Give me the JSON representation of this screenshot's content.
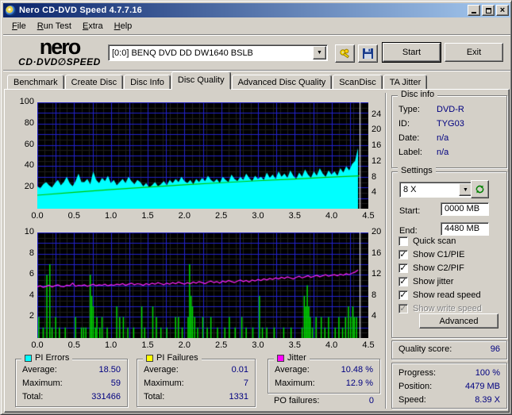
{
  "window": {
    "title": "Nero CD-DVD Speed 4.7.7.16"
  },
  "menu": {
    "items": [
      "File",
      "Run Test",
      "Extra",
      "Help"
    ]
  },
  "toolbar": {
    "logo_line1": "nero",
    "logo_cd": "CD·DVD",
    "logo_slash": "∅",
    "logo_speed": "SPEED",
    "drive_selector": "[0:0]   BENQ DVD DD DW1640 BSLB",
    "start_label": "Start",
    "exit_label": "Exit"
  },
  "tabs": {
    "items": [
      "Benchmark",
      "Create Disc",
      "Disc Info",
      "Disc Quality",
      "Advanced Disc Quality",
      "ScanDisc",
      "TA Jitter"
    ],
    "active": "Disc Quality"
  },
  "disc_info": {
    "title": "Disc info",
    "rows": [
      {
        "label": "Type:",
        "value": "DVD-R"
      },
      {
        "label": "ID:",
        "value": "TYG03"
      },
      {
        "label": "Date:",
        "value": "n/a"
      },
      {
        "label": "Label:",
        "value": "n/a"
      }
    ]
  },
  "settings": {
    "title": "Settings",
    "speed_value": "8 X",
    "start_label": "Start:",
    "start_value": "0000 MB",
    "end_label": "End:",
    "end_value": "4480 MB",
    "checkboxes": [
      {
        "label": "Quick scan",
        "checked": false,
        "disabled": false
      },
      {
        "label": "Show C1/PIE",
        "checked": true,
        "disabled": false
      },
      {
        "label": "Show C2/PIF",
        "checked": true,
        "disabled": false
      },
      {
        "label": "Show jitter",
        "checked": true,
        "disabled": false
      },
      {
        "label": "Show read speed",
        "checked": true,
        "disabled": false
      },
      {
        "label": "Show write speed",
        "checked": true,
        "disabled": true
      }
    ],
    "advanced_label": "Advanced"
  },
  "quality": {
    "label": "Quality score:",
    "value": "96"
  },
  "status": {
    "rows": [
      {
        "label": "Progress:",
        "value": "100 %"
      },
      {
        "label": "Position:",
        "value": "4479 MB"
      },
      {
        "label": "Speed:",
        "value": "8.39 X"
      }
    ]
  },
  "legends": {
    "pi_errors": {
      "title": "PI Errors",
      "swatch": "#00ffff",
      "rows": [
        {
          "label": "Average:",
          "value": "18.50"
        },
        {
          "label": "Maximum:",
          "value": "59"
        },
        {
          "label": "Total:",
          "value": "331466"
        }
      ]
    },
    "pi_failures": {
      "title": "PI Failures",
      "swatch": "#ffff00",
      "rows": [
        {
          "label": "Average:",
          "value": "0.01"
        },
        {
          "label": "Maximum:",
          "value": "7"
        },
        {
          "label": "Total:",
          "value": "1331"
        }
      ]
    },
    "jitter": {
      "title": "Jitter",
      "swatch": "#ff00ff",
      "rows": [
        {
          "label": "Average:",
          "value": "10.48 %"
        },
        {
          "label": "Maximum:",
          "value": "12.9 %"
        }
      ]
    },
    "po_failures": {
      "label": "PO failures:",
      "value": "0"
    }
  },
  "colors": {
    "face": "#d4d0c8",
    "value_text": "#000080",
    "title_gradient_left": "#0a246a",
    "title_gradient_right": "#a6caf0",
    "chart_bg": "#000000",
    "grid_major": "#2222cc",
    "grid_minor": "#1e1e1e",
    "cursor": "#ffffff"
  },
  "chart_data": [
    {
      "id": "pie",
      "type": "area",
      "title": "PI Errors scan (cyan area) with read speed overlay (green line)",
      "x_axis": {
        "min": 0,
        "max": 4.5,
        "tick_step": 0.5,
        "minor_step": 0.1,
        "major_step": 0.25,
        "tick_labels": [
          "0.0",
          "0.5",
          "1.0",
          "1.5",
          "2.0",
          "2.5",
          "3.0",
          "3.5",
          "4.0",
          "4.5"
        ]
      },
      "left_axis": {
        "min": 0,
        "max": 100,
        "ticks": [
          20,
          40,
          60,
          80,
          100
        ],
        "minor_step": 5,
        "major_step": 10
      },
      "right_axis": {
        "min": 0,
        "max": 27.2,
        "ticks": [
          4,
          8,
          12,
          16,
          20,
          24
        ]
      },
      "cursor_x": 4.38,
      "series": [
        {
          "name": "pi_errors",
          "kind": "area",
          "axis": "left",
          "color": "#00ffff",
          "x_start": 0,
          "x_step": 0.04,
          "y": [
            21,
            19,
            23,
            25,
            22,
            20,
            24,
            27,
            22,
            25,
            30,
            24,
            21,
            26,
            33,
            25,
            25,
            28,
            23,
            35,
            27,
            24,
            29,
            26,
            31,
            24,
            27,
            22,
            25,
            28,
            24,
            30,
            26,
            23,
            27,
            25,
            21,
            24,
            20,
            22,
            25,
            21,
            23,
            26,
            22,
            27,
            24,
            28,
            25,
            30,
            26,
            24,
            27,
            23,
            28,
            25,
            29,
            26,
            31,
            27,
            25,
            28,
            24,
            30,
            27,
            25,
            32,
            28,
            26,
            30,
            27,
            33,
            29,
            26,
            31,
            28,
            30,
            27,
            34,
            29,
            32,
            28,
            35,
            30,
            33,
            29,
            36,
            31,
            28,
            34,
            30,
            37,
            32,
            29,
            35,
            31,
            38,
            33,
            30,
            36,
            32,
            35,
            31,
            38,
            34,
            40,
            36,
            42,
            45,
            57
          ]
        },
        {
          "name": "read_speed",
          "kind": "line",
          "axis": "right",
          "color": "#00c800",
          "points": [
            [
              0,
              3.45
            ],
            [
              0.5,
              4.2
            ],
            [
              1,
              4.9
            ],
            [
              1.5,
              5.5
            ],
            [
              2,
              6.1
            ],
            [
              2.5,
              6.65
            ],
            [
              3,
              7.15
            ],
            [
              3.5,
              7.6
            ],
            [
              4,
              8.1
            ],
            [
              4.38,
              8.39
            ]
          ]
        }
      ]
    },
    {
      "id": "pif",
      "type": "bar",
      "title": "PI Failures scan (green bars) with jitter overlay (magenta line, %)",
      "x_axis": {
        "min": 0,
        "max": 4.5,
        "tick_step": 0.5,
        "minor_step": 0.1,
        "major_step": 0.25,
        "tick_labels": [
          "0.0",
          "0.5",
          "1.0",
          "1.5",
          "2.0",
          "2.5",
          "3.0",
          "3.5",
          "4.0",
          "4.5"
        ]
      },
      "left_axis": {
        "min": 0,
        "max": 10,
        "ticks": [
          2,
          4,
          6,
          8,
          10
        ],
        "minor_step": 0.5,
        "major_step": 1
      },
      "right_axis": {
        "min": 0,
        "max": 20,
        "ticks": [
          4,
          8,
          12,
          16,
          20
        ]
      },
      "cursor_x": 4.38,
      "series": [
        {
          "name": "pi_failures",
          "kind": "bars",
          "axis": "left",
          "color": "#00dc00",
          "bars": [
            [
              0.02,
              2
            ],
            [
              0.08,
              1
            ],
            [
              0.13,
              6
            ],
            [
              0.17,
              7
            ],
            [
              0.2,
              1
            ],
            [
              0.25,
              2
            ],
            [
              0.3,
              1
            ],
            [
              0.38,
              1
            ],
            [
              0.52,
              2
            ],
            [
              0.6,
              1
            ],
            [
              0.63,
              1
            ],
            [
              0.66,
              1
            ],
            [
              0.72,
              6
            ],
            [
              0.74,
              4
            ],
            [
              0.76,
              3
            ],
            [
              0.79,
              1
            ],
            [
              0.81,
              2
            ],
            [
              0.85,
              1
            ],
            [
              0.88,
              2
            ],
            [
              0.95,
              1
            ],
            [
              1.08,
              3
            ],
            [
              1.12,
              2
            ],
            [
              1.17,
              2
            ],
            [
              1.23,
              1
            ],
            [
              1.31,
              1
            ],
            [
              1.42,
              3
            ],
            [
              1.46,
              1
            ],
            [
              1.57,
              3
            ],
            [
              1.62,
              2
            ],
            [
              1.68,
              1
            ],
            [
              1.76,
              1
            ],
            [
              1.88,
              2
            ],
            [
              1.92,
              2
            ],
            [
              1.97,
              1
            ],
            [
              2.05,
              2
            ],
            [
              2.07,
              7
            ],
            [
              2.09,
              4
            ],
            [
              2.11,
              3
            ],
            [
              2.14,
              2
            ],
            [
              2.18,
              1
            ],
            [
              2.25,
              2
            ],
            [
              2.31,
              1
            ],
            [
              2.36,
              2
            ],
            [
              2.45,
              1
            ],
            [
              2.55,
              1
            ],
            [
              2.61,
              2
            ],
            [
              2.69,
              1
            ],
            [
              2.78,
              2
            ],
            [
              2.84,
              1
            ],
            [
              2.93,
              1
            ],
            [
              3.02,
              4
            ],
            [
              3.06,
              1
            ],
            [
              3.12,
              1
            ],
            [
              3.22,
              1
            ],
            [
              3.35,
              1
            ],
            [
              3.45,
              1
            ],
            [
              3.6,
              1
            ],
            [
              3.63,
              4
            ],
            [
              3.65,
              3
            ],
            [
              3.67,
              5
            ],
            [
              3.69,
              3
            ],
            [
              3.71,
              2
            ],
            [
              3.74,
              1
            ],
            [
              3.79,
              2
            ],
            [
              3.86,
              2
            ],
            [
              3.91,
              1
            ],
            [
              3.96,
              2
            ],
            [
              4.05,
              1
            ],
            [
              4.1,
              2
            ],
            [
              4.15,
              1
            ],
            [
              4.19,
              2
            ],
            [
              4.23,
              3
            ],
            [
              4.26,
              2
            ],
            [
              4.29,
              3
            ],
            [
              4.31,
              2
            ],
            [
              4.34,
              2
            ]
          ]
        },
        {
          "name": "jitter",
          "kind": "line",
          "axis": "right",
          "color": "#ff22ff",
          "x_start": 0,
          "x_step": 0.04,
          "y": [
            9.7,
            9.9,
            9.6,
            9.8,
            10.0,
            9.7,
            9.9,
            10.1,
            9.8,
            9.7,
            10.0,
            9.9,
            10.4,
            9.8,
            10.0,
            9.9,
            10.1,
            9.8,
            10.0,
            10.2,
            9.9,
            10.1,
            10.0,
            10.2,
            9.9,
            10.1,
            10.0,
            10.2,
            10.1,
            10.3,
            10.0,
            10.2,
            10.4,
            10.1,
            10.3,
            10.2,
            10.0,
            10.3,
            10.1,
            10.4,
            10.2,
            10.5,
            10.3,
            10.1,
            10.4,
            10.2,
            10.5,
            10.3,
            10.6,
            10.4,
            10.2,
            10.5,
            10.3,
            10.6,
            10.4,
            10.7,
            10.5,
            10.3,
            10.6,
            10.8,
            10.5,
            10.7,
            10.4,
            10.8,
            10.6,
            10.9,
            10.7,
            10.5,
            10.8,
            11.0,
            10.7,
            10.9,
            10.6,
            11.0,
            10.8,
            11.1,
            10.9,
            11.2,
            11.0,
            11.3,
            11.1,
            11.4,
            11.2,
            11.5,
            11.3,
            11.6,
            11.4,
            11.2,
            11.5,
            11.7,
            11.4,
            11.6,
            11.8,
            11.5,
            11.7,
            11.9,
            11.6,
            11.8,
            12.0,
            11.7,
            11.9,
            12.0,
            11.8,
            12.1,
            11.9,
            12.2,
            12.0,
            12.3,
            12.5,
            12.9
          ]
        }
      ]
    }
  ]
}
